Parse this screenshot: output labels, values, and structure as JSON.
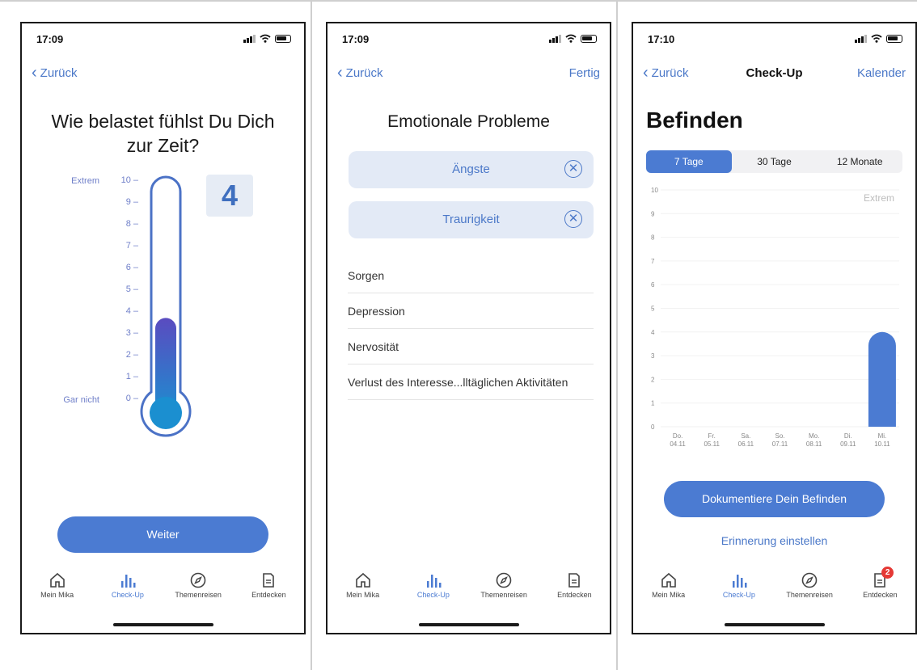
{
  "status": {
    "time1": "17:09",
    "time2": "17:09",
    "time3": "17:10"
  },
  "nav": {
    "back": "Zurück",
    "done": "Fertig",
    "checkup_title": "Check-Up",
    "calendar": "Kalender"
  },
  "screen1": {
    "question": "Wie belastet fühlst Du Dich zur Zeit?",
    "scale_max_label": "Extrem",
    "scale_min_label": "Gar nicht",
    "ticks": [
      "10",
      "9",
      "8",
      "7",
      "6",
      "5",
      "4",
      "3",
      "2",
      "1",
      "0"
    ],
    "value": "4",
    "level": 4,
    "button": "Weiter"
  },
  "screen2": {
    "title": "Emotionale Probleme",
    "selected": [
      "Ängste",
      "Traurigkeit"
    ],
    "options": [
      "Sorgen",
      "Depression",
      "Nervosität",
      "Verlust des Interesse...lltäglichen Aktivitäten"
    ]
  },
  "screen3": {
    "title": "Befinden",
    "segments": [
      "7 Tage",
      "30 Tage",
      "12 Monate"
    ],
    "active_segment": 0,
    "button": "Dokumentiere Dein Befinden",
    "link": "Erinnerung einstellen"
  },
  "chart_data": {
    "type": "bar",
    "categories": [
      "Do. 04.11",
      "Fr. 05.11",
      "Sa. 06.11",
      "So. 07.11",
      "Mo. 08.11",
      "Di. 09.11",
      "Mi. 10.11"
    ],
    "day_labels": [
      "Do.",
      "Fr.",
      "Sa.",
      "So.",
      "Mo.",
      "Di.",
      "Mi."
    ],
    "date_labels": [
      "04.11",
      "05.11",
      "06.11",
      "07.11",
      "08.11",
      "09.11",
      "10.11"
    ],
    "values": [
      null,
      null,
      null,
      null,
      null,
      null,
      4
    ],
    "y_ticks": [
      "10",
      "9",
      "8",
      "7",
      "6",
      "5",
      "4",
      "3",
      "2",
      "1",
      "0"
    ],
    "ylim": [
      0,
      10
    ],
    "annotation": "Extrem",
    "bar_color": "#4b7bd2"
  },
  "tabbar": {
    "tabs": [
      "Mein Mika",
      "Check-Up",
      "Themenreisen",
      "Entdecken"
    ],
    "badge": "2"
  },
  "colors": {
    "accent": "#4b7bd2",
    "badge": "#e53935"
  }
}
